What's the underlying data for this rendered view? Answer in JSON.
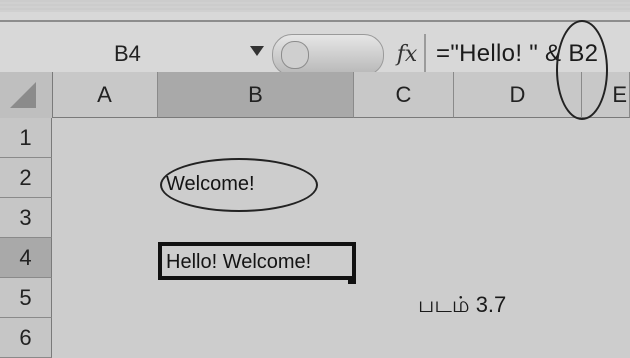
{
  "formula_bar": {
    "name_box": "B4",
    "fx_label": "fx",
    "formula": "=\"Hello! \" & B2"
  },
  "columns": [
    "A",
    "B",
    "C",
    "D",
    "E"
  ],
  "rows": [
    "1",
    "2",
    "3",
    "4",
    "5",
    "6"
  ],
  "cells": {
    "B2": "Welcome!",
    "B4": "Hello! Welcome!"
  },
  "caption": "படம் 3.7"
}
